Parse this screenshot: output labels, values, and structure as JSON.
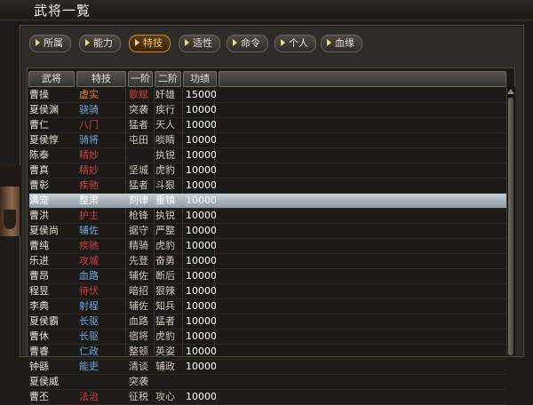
{
  "window": {
    "title": "武将一覧"
  },
  "tabs": [
    {
      "label": "所属",
      "active": false
    },
    {
      "label": "能力",
      "active": false
    },
    {
      "label": "特技",
      "active": true
    },
    {
      "label": "适性",
      "active": false
    },
    {
      "label": "命令",
      "active": false
    },
    {
      "label": "个人",
      "active": false
    },
    {
      "label": "血缘",
      "active": false
    }
  ],
  "table": {
    "headers": [
      "武将",
      "特技",
      "一阶",
      "二阶",
      "功绩"
    ],
    "rows": [
      {
        "name": "曹操",
        "skill": "虚实",
        "skill_color": "#e0862a",
        "r1": "歌赋",
        "r1_color": "#d04040",
        "r2": "奸雄",
        "merit": "15000"
      },
      {
        "name": "夏侯渊",
        "skill": "骁骑",
        "skill_color": "#6fa8dc",
        "r1": "突袭",
        "r2": "疾行",
        "merit": "10000"
      },
      {
        "name": "曹仁",
        "skill": "八门",
        "skill_color": "#d04040",
        "r1": "猛者",
        "r2": "天人",
        "merit": "10000"
      },
      {
        "name": "夏侯惇",
        "skill": "骑将",
        "skill_color": "#6fa8dc",
        "r1": "屯田",
        "r2": "啖睛",
        "merit": "10000"
      },
      {
        "name": "陈泰",
        "skill": "精妙",
        "skill_color": "#d04040",
        "r1": "",
        "r2": "执锐",
        "merit": "10000"
      },
      {
        "name": "曹真",
        "skill": "精妙",
        "skill_color": "#d04040",
        "r1": "坚城",
        "r2": "虎豹",
        "merit": "10000"
      },
      {
        "name": "曹彰",
        "skill": "疾驰",
        "skill_color": "#d04040",
        "r1": "猛者",
        "r2": "斗狠",
        "merit": "10000"
      },
      {
        "name": "满宠",
        "skill": "整肃",
        "skill_color": "#ffffff",
        "r1": "刻律",
        "r2": "重镇",
        "merit": "10000",
        "selected": true
      },
      {
        "name": "曹洪",
        "skill": "护主",
        "skill_color": "#d04040",
        "r1": "枪锋",
        "r2": "执锐",
        "merit": "10000"
      },
      {
        "name": "夏侯尚",
        "skill": "辅佐",
        "skill_color": "#6fa8dc",
        "r1": "据守",
        "r2": "严整",
        "merit": "10000"
      },
      {
        "name": "曹纯",
        "skill": "疾驰",
        "skill_color": "#d04040",
        "r1": "精骑",
        "r2": "虎豹",
        "merit": "10000"
      },
      {
        "name": "乐进",
        "skill": "攻城",
        "skill_color": "#d04040",
        "r1": "先登",
        "r2": "奋勇",
        "merit": "10000"
      },
      {
        "name": "曹昂",
        "skill": "血路",
        "skill_color": "#6fa8dc",
        "r1": "辅佐",
        "r2": "断后",
        "merit": "10000"
      },
      {
        "name": "程昱",
        "skill": "待伏",
        "skill_color": "#d04040",
        "r1": "暗招",
        "r2": "狠辣",
        "merit": "10000"
      },
      {
        "name": "李典",
        "skill": "射程",
        "skill_color": "#6fa8dc",
        "r1": "辅佐",
        "r2": "知兵",
        "merit": "10000"
      },
      {
        "name": "夏侯霸",
        "skill": "长驱",
        "skill_color": "#6fa8dc",
        "r1": "血路",
        "r2": "猛者",
        "merit": "10000"
      },
      {
        "name": "曹休",
        "skill": "长驱",
        "skill_color": "#6fa8dc",
        "r1": "宿将",
        "r2": "虎豹",
        "merit": "10000"
      },
      {
        "name": "曹睿",
        "skill": "仁政",
        "skill_color": "#6fa8dc",
        "r1": "整顿",
        "r2": "英姿",
        "merit": "10000"
      },
      {
        "name": "钟繇",
        "skill": "能吏",
        "skill_color": "#6fa8dc",
        "r1": "清谈",
        "r2": "辅政",
        "merit": "10000"
      },
      {
        "name": "夏侯威",
        "skill": "",
        "skill_color": "#6fa8dc",
        "r1": "突袭",
        "r2": "",
        "merit": ""
      },
      {
        "name": "曹丕",
        "skill": "法治",
        "skill_color": "#d04040",
        "r1": "征税",
        "r2": "攻心",
        "merit": "10000"
      }
    ]
  },
  "colors": {
    "tab_active_text": "#f6d06a",
    "selected_row": "#aab4bc",
    "skill_red": "#d04040",
    "skill_blue": "#6fa8dc",
    "skill_orange": "#e0862a"
  }
}
